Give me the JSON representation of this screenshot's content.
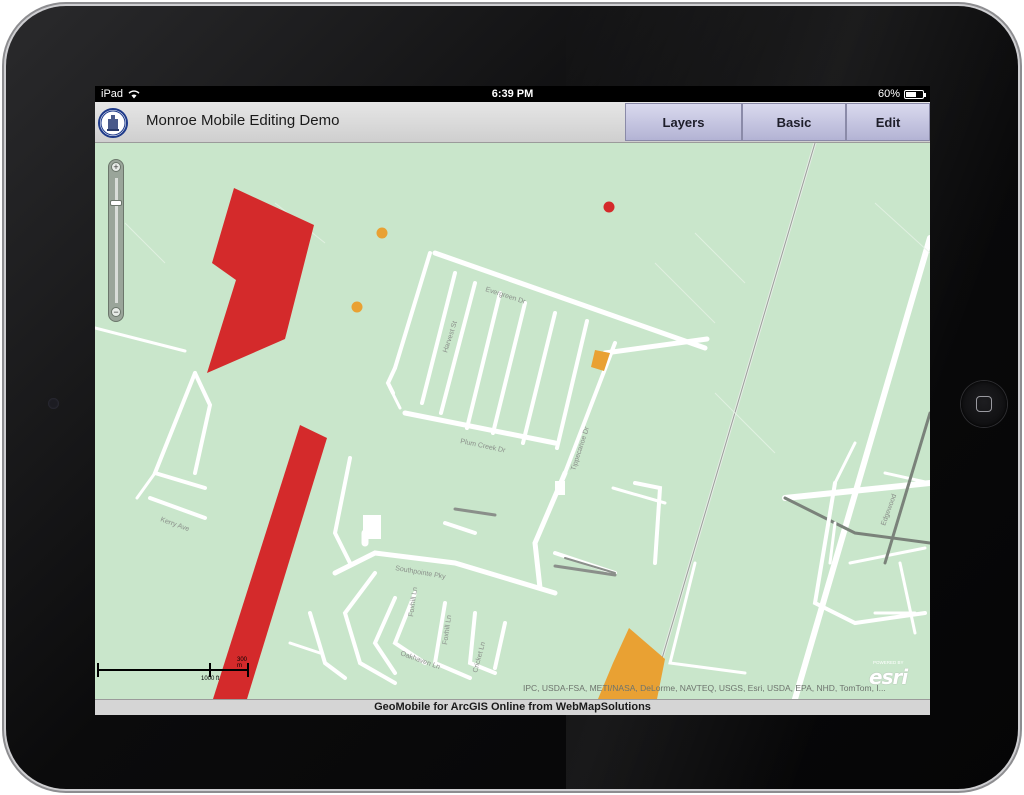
{
  "status_bar": {
    "device": "iPad",
    "time": "6:39 PM",
    "battery_text": "60%",
    "battery_level": 0.6
  },
  "app": {
    "title": "Monroe Mobile Editing Demo",
    "tabs": [
      {
        "label": "Layers"
      },
      {
        "label": "Basic"
      },
      {
        "label": "Edit"
      }
    ]
  },
  "map": {
    "street_labels": {
      "evergreen": "Evergreen Dr",
      "harvest": "Harvest St",
      "plum_creek": "Plum Creek Dr",
      "tippecanoe": "Tippecanoe Dr",
      "southpointe": "Southpointe Pky",
      "foxhill1": "Foxhill Ln",
      "foxhill2": "Foxhill Ln",
      "oakhaven": "Oakhaven Ln",
      "cricket": "Cricket Ln",
      "kerry": "Kerry Ave",
      "edgewood": "Edgewood"
    },
    "scale": {
      "label_top": "300 m",
      "label_bottom": "1000 ft"
    },
    "attribution": "IPC, USDA-FSA, METI/NASA, DeLorme, NAVTEQ, USGS, Esri, USDA, EPA, NHD, TomTom, I...",
    "esri_logo": "esri",
    "esri_powered": "POWERED BY",
    "colors": {
      "base": "#c9e6cb",
      "road": "#ffffff",
      "feature_red": "#d42a2b",
      "feature_orange": "#e9a133"
    }
  },
  "footer": {
    "text": "GeoMobile for ArcGIS Online from WebMapSolutions"
  }
}
